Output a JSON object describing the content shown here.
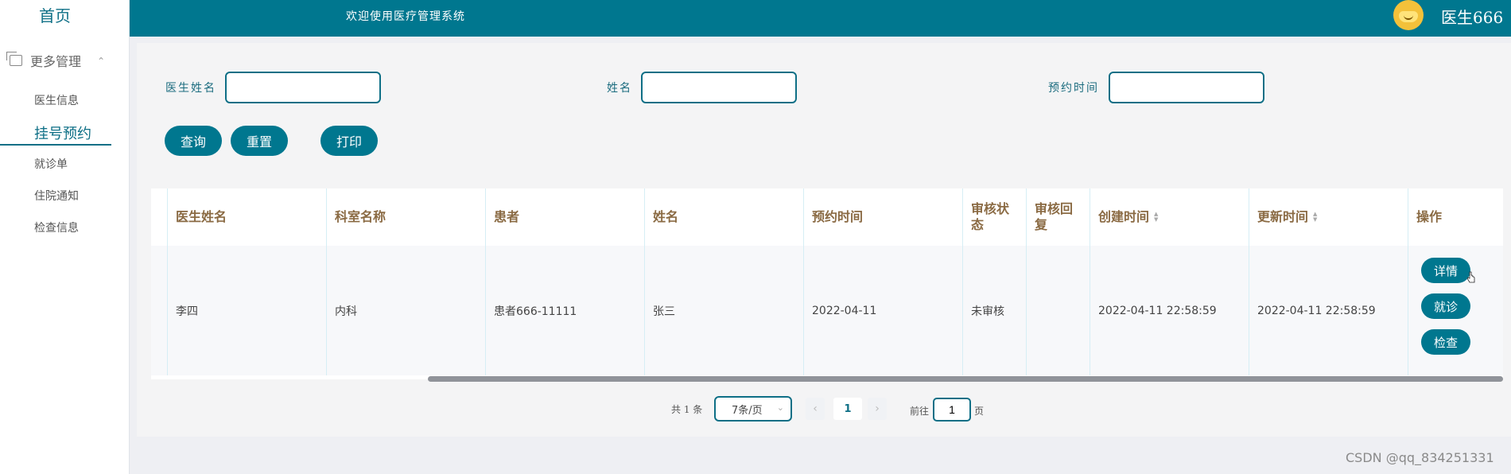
{
  "sidebar": {
    "home": "首页",
    "group": "更多管理",
    "items": [
      "医生信息",
      "挂号预约",
      "就诊单",
      "住院通知",
      "检查信息"
    ]
  },
  "header": {
    "welcome": "欢迎使用医疗管理系统",
    "username": "医生666"
  },
  "search": {
    "doctor_label": "医生姓名",
    "name_label": "姓名",
    "time_label": "预约时间",
    "doctor_value": "",
    "name_value": "",
    "time_value": "",
    "query_btn": "查询",
    "reset_btn": "重置",
    "print_btn": "打印"
  },
  "table": {
    "headers": [
      "医生姓名",
      "科室名称",
      "患者",
      "姓名",
      "预约时间",
      "审核状\n态",
      "审核回\n复",
      "创建时间",
      "更新时间",
      "操作"
    ],
    "rows": [
      {
        "doctor": "李四",
        "dept": "内科",
        "patient": "患者666-11111",
        "name": "张三",
        "appt_time": "2022-04-11",
        "status": "未审核",
        "reply": "",
        "created": "2022-04-11 22:58:59",
        "updated": "2022-04-11 22:58:59",
        "actions": [
          "详情",
          "就诊",
          "检查"
        ]
      }
    ]
  },
  "pager": {
    "total": "共 1 条",
    "page_size": "7条/页",
    "current_page": "1",
    "goto_label": "前往",
    "goto_value": "1",
    "page_suffix": "页"
  },
  "watermark": "CSDN @qq_834251331",
  "colors": {
    "primary": "#00778f",
    "header_text": "#8a6a43"
  }
}
